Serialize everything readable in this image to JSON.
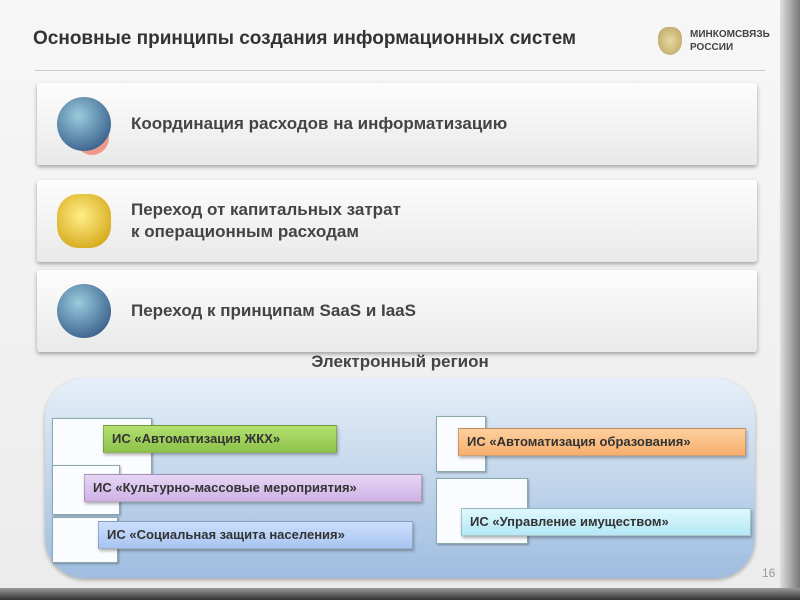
{
  "header": {
    "title": "Основные принципы создания информационных систем",
    "logo_line1": "МИНКОМСВЯЗЬ",
    "logo_line2": "РОССИИ"
  },
  "principles": [
    {
      "text": "Координация расходов на информатизацию",
      "icon": "globe-money-icon"
    },
    {
      "text_line1": "Переход от капитальных затрат",
      "text_line2": "к операционным расходам",
      "icon": "coins-icon"
    },
    {
      "text": "Переход к принципам SaaS и IaaS",
      "icon": "globe-table-icon"
    }
  ],
  "region": {
    "title": "Электронный регион",
    "systems": [
      {
        "label": "ИС «Автоматизация ЖКХ»",
        "color": "#9fd05a"
      },
      {
        "label": "ИС «Культурно-массовые мероприятия»",
        "color": "#d9c2ec"
      },
      {
        "label": "ИС «Социальная защита населения»",
        "color": "#b8d0f7"
      },
      {
        "label": "ИС «Автоматизация образования»",
        "color": "#fbbf86"
      },
      {
        "label": "ИС «Управление имуществом»",
        "color": "#c8f0fa"
      }
    ]
  },
  "page_number": "16"
}
